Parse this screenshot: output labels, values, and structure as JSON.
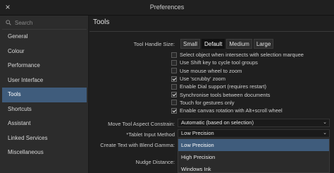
{
  "window": {
    "title": "Preferences",
    "close_glyph": "×"
  },
  "sidebar": {
    "search_placeholder": "Search",
    "items": [
      {
        "label": "General"
      },
      {
        "label": "Colour"
      },
      {
        "label": "Performance"
      },
      {
        "label": "User Interface"
      },
      {
        "label": "Tools"
      },
      {
        "label": "Shortcuts"
      },
      {
        "label": "Assistant"
      },
      {
        "label": "Linked Services"
      },
      {
        "label": "Miscellaneous"
      }
    ],
    "active": "Tools"
  },
  "main": {
    "title": "Tools",
    "tool_handle_size": {
      "label": "Tool Handle Size:",
      "options": [
        "Small",
        "Default",
        "Medium",
        "Large"
      ],
      "selected": "Default"
    },
    "checkboxes": [
      {
        "label": "Select object when intersects with selection marquee",
        "checked": false
      },
      {
        "label": "Use Shift key to cycle tool groups",
        "checked": false
      },
      {
        "label": "Use mouse wheel to zoom",
        "checked": false
      },
      {
        "label": "Use 'scrubby' zoom",
        "checked": true
      },
      {
        "label": "Enable Dial support (requires restart)",
        "checked": false
      },
      {
        "label": "Synchronise tools between documents",
        "checked": true
      },
      {
        "label": "Touch for gestures only",
        "checked": false
      },
      {
        "label": "Enable canvas rotation with Alt+scroll wheel",
        "checked": true
      }
    ],
    "move_tool_aspect": {
      "label": "Move Tool Aspect Constrain:",
      "value": "Automatic (based on selection)"
    },
    "tablet_input": {
      "label": "*Tablet Input Method",
      "value": "Low Precision"
    },
    "create_text_blend": {
      "label": "Create Text with Blend Gamma:"
    },
    "nudge_distance": {
      "label": "Nudge Distance:"
    },
    "dropdown_options": [
      "Low Precision",
      "High Precision",
      "Windows Ink"
    ],
    "dropdown_highlighted": "Low Precision"
  },
  "colors": {
    "accent": "#3f5c7c",
    "background": "#1f1f1f",
    "sidebar": "#2c2c2c"
  }
}
